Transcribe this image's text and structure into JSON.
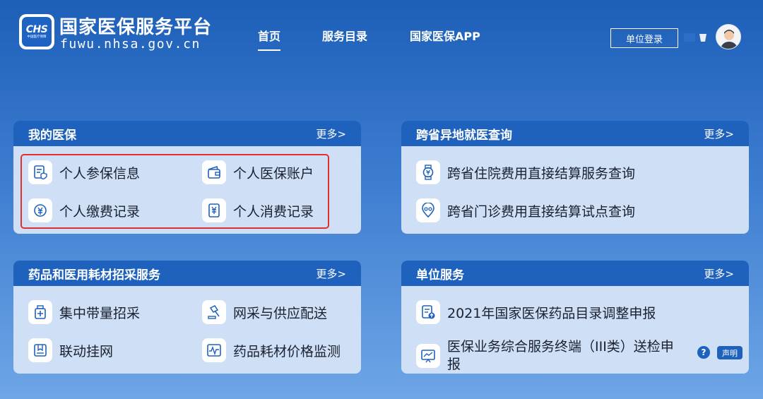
{
  "header": {
    "logo_text": "CHS",
    "logo_subtext": "中国医疗保障",
    "title": "国家医保服务平台",
    "domain": "fuwu.nhsa.gov.cn",
    "nav": [
      {
        "label": "首页",
        "active": true
      },
      {
        "label": "服务目录",
        "active": false
      },
      {
        "label": "国家医保APP",
        "active": false
      }
    ],
    "login_label": "单位登录"
  },
  "panels": {
    "my_insurance": {
      "title": "我的医保",
      "more": "更多>",
      "items": [
        {
          "label": "个人参保信息",
          "icon": "shield-document-icon"
        },
        {
          "label": "个人医保账户",
          "icon": "wallet-icon"
        },
        {
          "label": "个人缴费记录",
          "icon": "yen-coin-icon"
        },
        {
          "label": "个人消费记录",
          "icon": "yen-receipt-icon"
        }
      ]
    },
    "cross_province": {
      "title": "跨省异地就医查询",
      "more": "更多>",
      "items": [
        {
          "label": "跨省住院费用直接结算服务查询",
          "icon": "yen-watch-icon"
        },
        {
          "label": "跨省门诊费用直接结算试点查询",
          "icon": "location-pin-icon"
        }
      ]
    },
    "drug_procurement": {
      "title": "药品和医用耗材招采服务",
      "more": "更多>",
      "items": [
        {
          "label": "集中带量招采",
          "icon": "medicine-box-icon"
        },
        {
          "label": "网采与供应配送",
          "icon": "gavel-icon"
        },
        {
          "label": "联动挂网",
          "icon": "bookmark-icon"
        },
        {
          "label": "药品耗材价格监测",
          "icon": "pulse-monitor-icon"
        }
      ]
    },
    "unit_services": {
      "title": "单位服务",
      "more": "更多>",
      "items": [
        {
          "label": "2021年国家医保药品目录调整申报",
          "icon": "document-upload-icon"
        },
        {
          "label": "医保业务综合服务终端（III类）送检申报",
          "icon": "chart-board-icon"
        }
      ]
    }
  },
  "footer": {
    "help_symbol": "?",
    "statement_label": "声明"
  },
  "colors": {
    "header_bar": "#1f62be",
    "panel_bg": "#cfe0f6",
    "highlight_border": "#e0322c"
  }
}
